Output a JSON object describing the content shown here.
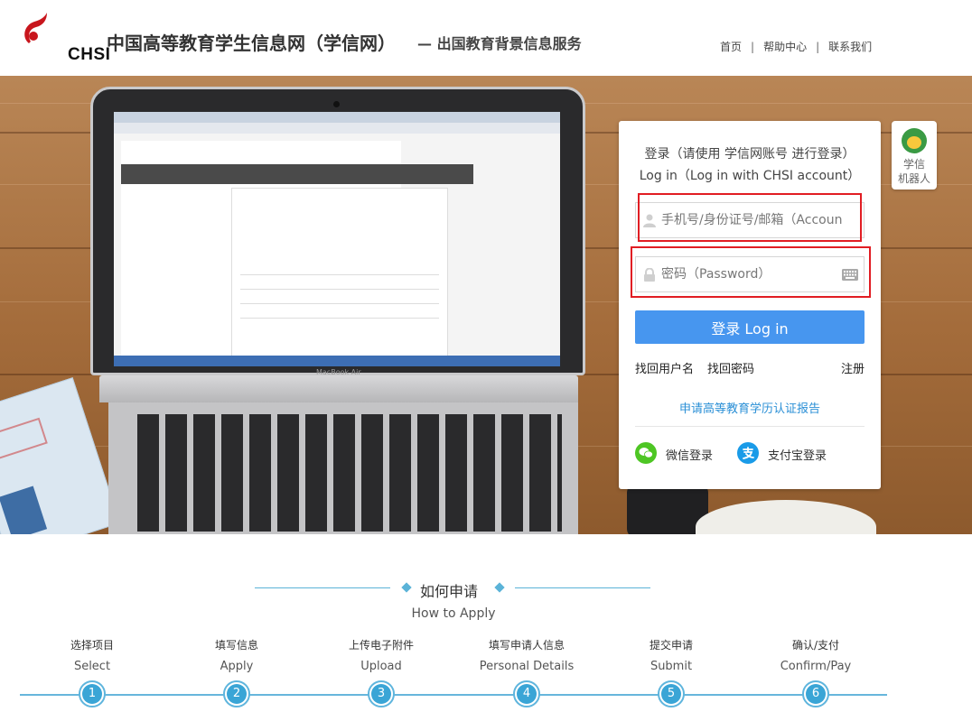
{
  "header": {
    "logo_text": "CHSI",
    "site_title": "中国高等教育学生信息网（学信网）",
    "site_subtitle": "— 出国教育背景信息服务",
    "nav": {
      "home": "首页",
      "help": "帮助中心",
      "contact": "联系我们",
      "separator": "|"
    }
  },
  "hero": {
    "laptop_label": "MacBook Air"
  },
  "login": {
    "title_cn": "登录（请使用 学信网账号 进行登录）",
    "title_en": "Log in（Log in with CHSI account）",
    "account_placeholder": "手机号/身份证号/邮箱（Account）",
    "password_placeholder": "密码（Password）",
    "submit_label": "登录 Log in",
    "recover_username": "找回用户名",
    "recover_password": "找回密码",
    "register": "注册",
    "apply_link": "申请高等教育学历认证报告",
    "wechat_login": "微信登录",
    "alipay_login": "支付宝登录",
    "colors": {
      "button": "#4796ef",
      "link": "#2a8fd6",
      "highlight_box": "#e11d23"
    }
  },
  "robot": {
    "label_line1": "学信",
    "label_line2": "机器人"
  },
  "how_to_apply": {
    "title_cn": "如何申请",
    "title_en": "How to Apply",
    "steps": [
      {
        "cn": "选择项目",
        "en": "Select",
        "number": "1"
      },
      {
        "cn": "填写信息",
        "en": "Apply",
        "number": "2"
      },
      {
        "cn": "上传电子附件",
        "en": "Upload",
        "number": "3"
      },
      {
        "cn": "填写申请人信息",
        "en": "Personal Details",
        "number": "4"
      },
      {
        "cn": "提交申请",
        "en": "Submit",
        "number": "5"
      },
      {
        "cn": "确认/支付",
        "en": "Confirm/Pay",
        "number": "6"
      }
    ],
    "accent_color": "#3aa5d6"
  }
}
